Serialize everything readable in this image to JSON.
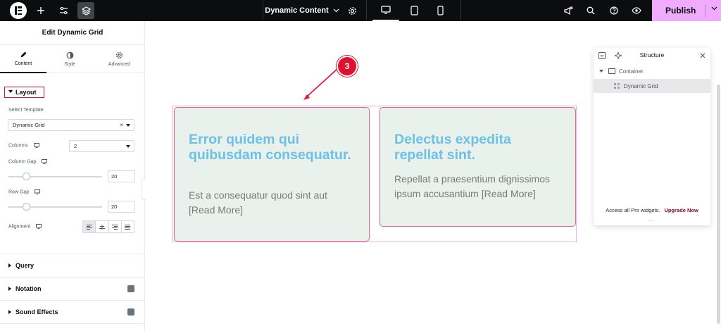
{
  "topbar": {
    "document_title": "Dynamic Content",
    "publish_label": "Publish",
    "colors": {
      "bg": "#0c0d0e",
      "publish_bg": "#f0abfc",
      "notify_dot": "#f0abfc"
    }
  },
  "panel": {
    "title": "Edit Dynamic Grid",
    "tabs": [
      {
        "label": "Content",
        "icon": "pencil-icon"
      },
      {
        "label": "Style",
        "icon": "contrast-icon"
      },
      {
        "label": "Advanced",
        "icon": "gear-icon"
      }
    ],
    "layout_section": "Layout",
    "fields": {
      "select_template_label": "Select Template",
      "select_template_value": "Dynamic Grid",
      "columns_label": "Columns",
      "columns_value": "2",
      "column_gap_label": "Column Gap",
      "column_gap_value": "20",
      "row_gap_label": "Row Gap",
      "row_gap_value": "20",
      "alignment_label": "Alignment"
    },
    "sections": [
      {
        "label": "Query"
      },
      {
        "label": "Notation"
      },
      {
        "label": "Sound Effects"
      }
    ]
  },
  "canvas": {
    "cards": [
      {
        "title": "Error quidem qui quibusdam consequatur.",
        "text": "Est a consequatur quod sint aut [Read More]"
      },
      {
        "title": "Delectus expedita repellat sint.",
        "text": "Repellat a praesentium dignissimos ipsum accusantium [Read More]"
      }
    ],
    "annotation_number": "3",
    "colors": {
      "card_bg": "#e8f1ec",
      "card_border": "#e06b7f",
      "title": "#6ec1e4",
      "text": "#7a7a7a",
      "annotation": "#e0102f"
    }
  },
  "structure": {
    "title": "Structure",
    "items": [
      {
        "label": "Container"
      },
      {
        "label": "Dynamic Grid"
      }
    ],
    "footer_text": "Access all Pro widgets.",
    "footer_link": "Upgrade Now"
  }
}
